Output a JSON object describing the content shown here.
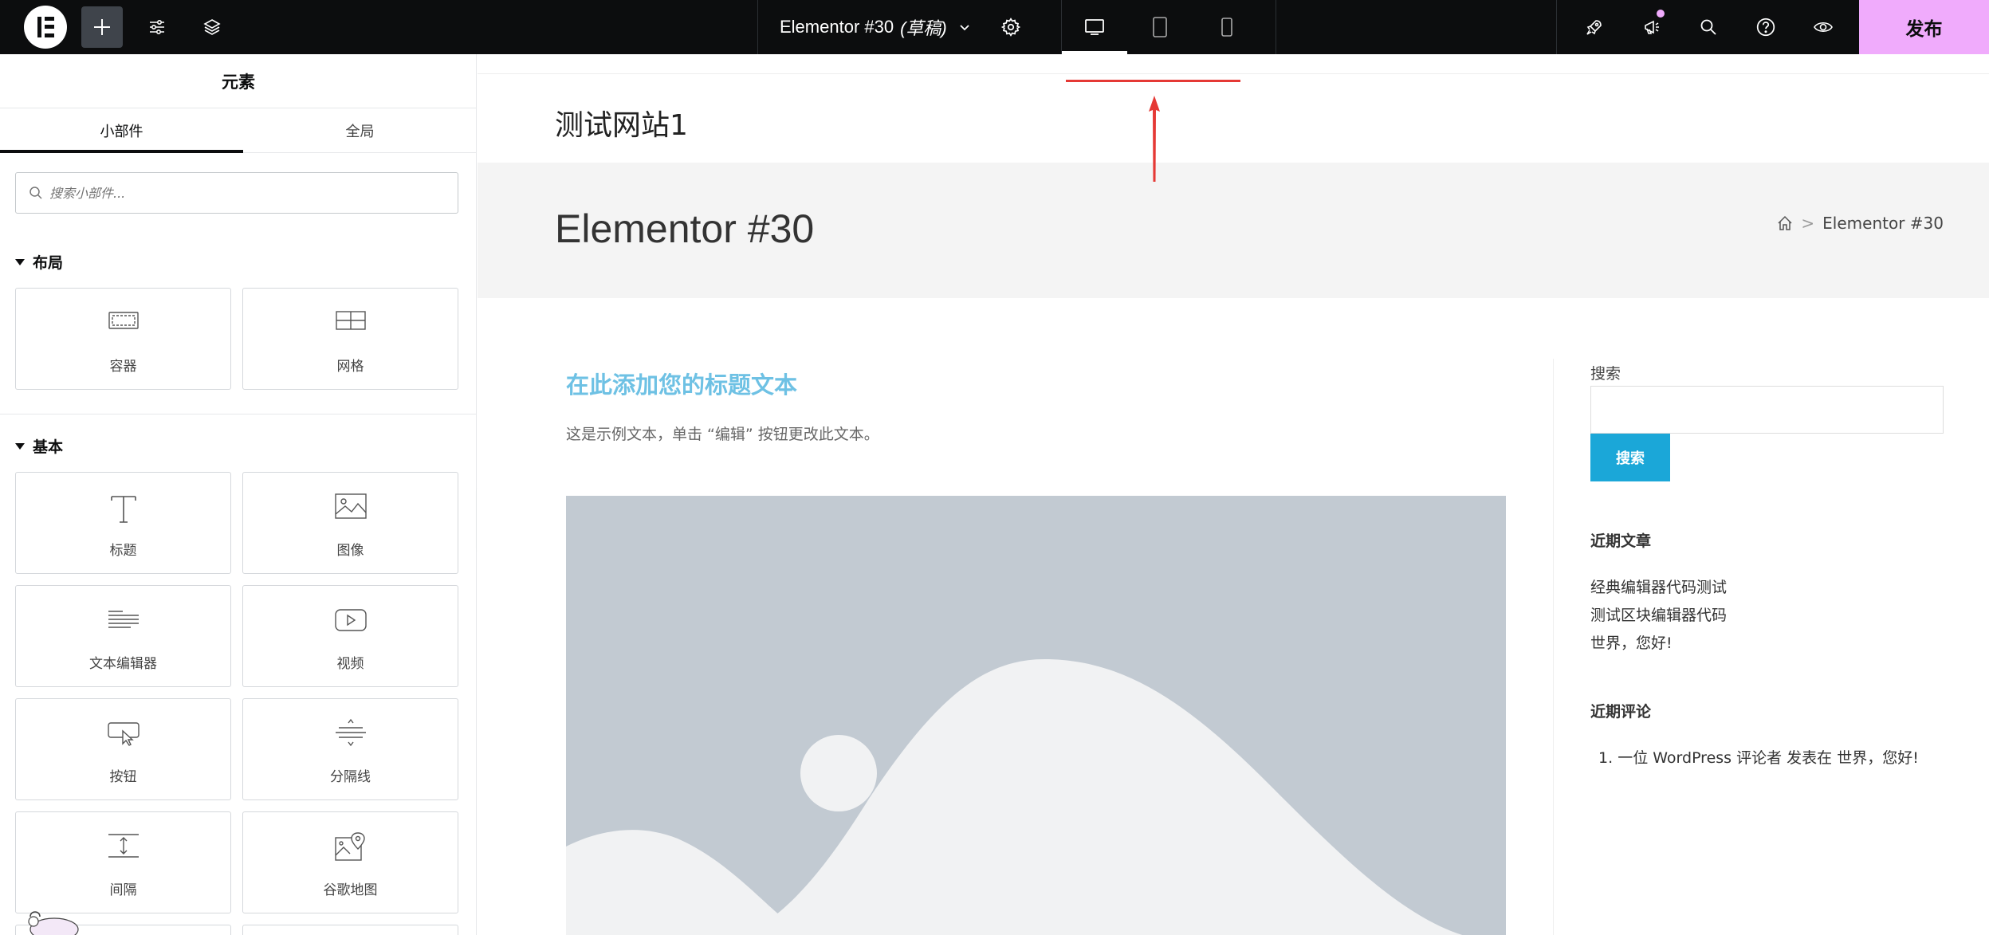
{
  "topbar": {
    "doc_title": "Elementor #30",
    "doc_status": "(草稿)",
    "publish_label": "发布"
  },
  "panel": {
    "title": "元素",
    "tabs": [
      "小部件",
      "全局"
    ],
    "search_placeholder": "搜索小部件...",
    "categories": {
      "layout": {
        "label": "布局",
        "widgets": [
          "容器",
          "网格"
        ]
      },
      "basic": {
        "label": "基本",
        "widgets": [
          "标题",
          "图像",
          "文本编辑器",
          "视频",
          "按钮",
          "分隔线",
          "间隔",
          "谷歌地图"
        ]
      }
    }
  },
  "canvas": {
    "site_title": "测试网站1",
    "page_title": "Elementor #30",
    "breadcrumb_current": "Elementor #30",
    "post_heading": "在此添加您的标题文本",
    "post_text": "这是示例文本，单击 “编辑” 按钮更改此文本。",
    "sidebar": {
      "search_label": "搜索",
      "search_button": "搜索",
      "recent_posts_title": "近期文章",
      "recent_posts": [
        "经典编辑器代码测试",
        "测试区块编辑器代码",
        "世界，您好!"
      ],
      "recent_comments_title": "近期评论",
      "recent_comments": [
        {
          "num": "1.",
          "author": "一位 WordPress 评论者",
          "mid": "发表在",
          "post": "世界，您好!"
        }
      ]
    }
  },
  "colors": {
    "topbar_bg": "#0c0d0e",
    "publish_bg": "#f0abfc",
    "heading_accent": "#6ec1e4",
    "search_button": "#1ba7d8",
    "annotation_red": "#e53935"
  }
}
